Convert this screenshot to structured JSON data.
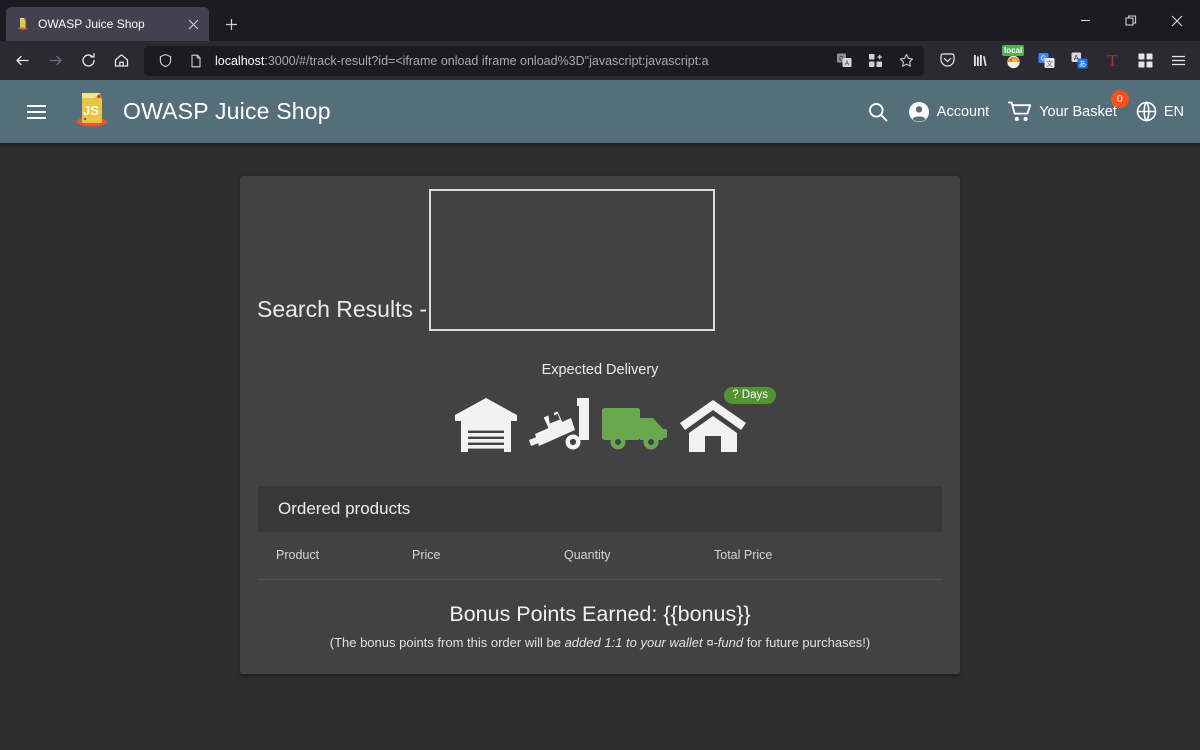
{
  "window": {
    "controls": {
      "minimize": "minimize-icon",
      "restore": "restore-icon",
      "close": "close-icon"
    }
  },
  "tabs": {
    "active": {
      "title": "OWASP Juice Shop",
      "favicon": "juice-box-icon",
      "close_label": "×"
    },
    "new_tab_label": "+"
  },
  "toolbar": {
    "back_label": "←",
    "forward_label": "→",
    "reload_label": "↻",
    "home_label": "⌂",
    "url": {
      "host": "localhost",
      "path": ":3000/#/track-result?id=<iframe onload iframe onload%3D\"javascript:javascript:a",
      "full": "localhost:3000/#/track-result?id=<iframe onload iframe onload%3D\"javascript:javascript:a",
      "shield_icon": "shield-icon",
      "page_icon": "page-icon",
      "translate_icon": "translate-icon",
      "extensions_icon": "extensions-grid-icon",
      "bookmark_icon": "star-icon"
    },
    "right_icons": [
      {
        "name": "pocket-icon",
        "badge": ""
      },
      {
        "name": "library-icon",
        "badge": ""
      },
      {
        "name": "firefox-extension-icon",
        "badge": "local"
      },
      {
        "name": "google-translate-icon",
        "badge": ""
      },
      {
        "name": "japanese-translate-icon",
        "badge": ""
      },
      {
        "name": "t-extension-icon",
        "badge": ""
      },
      {
        "name": "extensions-grid-icon",
        "badge": ""
      },
      {
        "name": "app-menu-icon",
        "badge": ""
      }
    ]
  },
  "appbar": {
    "menu_icon": "hamburger-menu-icon",
    "brand_name": "OWASP Juice Shop",
    "brand_logo": "juice-carton-logo",
    "search_icon": "search-icon",
    "account_label": "Account",
    "account_icon": "account-circle-icon",
    "basket_label": "Your Basket",
    "basket_icon": "shopping-cart-icon",
    "basket_count": "0",
    "language_label": "EN",
    "language_icon": "globe-icon",
    "background_color": "#546e7a",
    "badge_color": "#f4511e"
  },
  "main": {
    "search_results_label": "Search Results -",
    "injected_iframe": "xss-injected-iframe",
    "delivery": {
      "title": "Expected Delivery",
      "steps": [
        {
          "name": "warehouse-icon",
          "active": false
        },
        {
          "name": "hand-truck-icon",
          "active": false
        },
        {
          "name": "delivery-truck-icon",
          "active": true
        },
        {
          "name": "home-icon",
          "active": false
        }
      ],
      "eta_badge": "? Days",
      "active_color": "#6aa84f",
      "badge_color": "#539330"
    },
    "ordered_products": {
      "title": "Ordered products",
      "columns": [
        "Product",
        "Price",
        "Quantity",
        "Total Price"
      ],
      "rows": []
    },
    "bonus": {
      "headline": "Bonus Points Earned: {{bonus}}",
      "note_prefix": "(The bonus points from this order will be ",
      "note_italic": "added 1:1 to your wallet ¤-fund",
      "note_suffix": " for future purchases!)"
    }
  },
  "colors": {
    "page_background": "#2e2e2e",
    "card_background": "#424242",
    "section_bar": "#383838"
  }
}
